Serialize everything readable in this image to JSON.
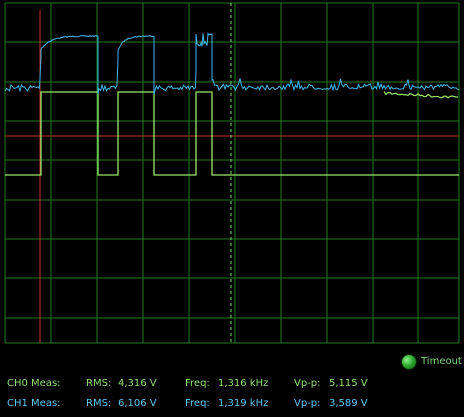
{
  "status": {
    "label": "Timeout",
    "indicator_color": "#2fae2f"
  },
  "channels": [
    {
      "name": "CH0 Meas:",
      "rms_label": "RMS:",
      "rms": "4,316 V",
      "freq_label": "Freq:",
      "freq": "1,316 kHz",
      "vpp_label": "Vp-p:",
      "vpp": "5,115 V",
      "color": "#8fe070"
    },
    {
      "name": "CH1 Meas:",
      "rms_label": "RMS:",
      "rms": "6,106 V",
      "freq_label": "Freq:",
      "freq": "1,319 kHz",
      "vpp_label": "Vp-p:",
      "vpp": "3,589 V",
      "color": "#5fc8f0"
    }
  ],
  "colors": {
    "grid": "#1f7a1f",
    "cursor_v_left": "#c0392b",
    "cursor_v_mid": "#6fe06f",
    "cursor_h": "#c0392b",
    "trace_ch0": "#9ae86a",
    "trace_ch1": "#3fb8e8"
  }
}
